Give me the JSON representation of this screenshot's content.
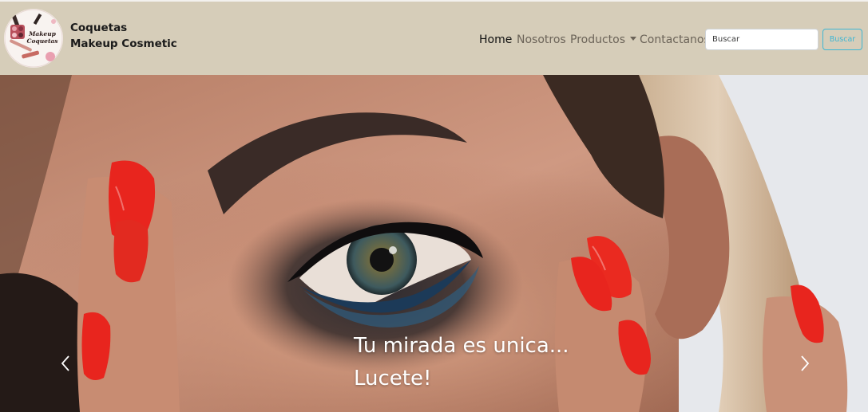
{
  "brand": {
    "logo_text": "Makeup Coquetas",
    "line1": "Coquetas",
    "line2": "Makeup Cosmetic"
  },
  "nav": {
    "items": [
      {
        "label": "Home",
        "active": true
      },
      {
        "label": "Nosotros",
        "active": false
      },
      {
        "label": "Productos",
        "active": false,
        "dropdown": true
      },
      {
        "label": "Contactanos",
        "active": false
      }
    ]
  },
  "search": {
    "placeholder": "Buscar",
    "value": "",
    "button_label": "Buscar"
  },
  "carousel": {
    "caption_line1": "Tu mirada es unica...",
    "caption_line2": "Lucete!",
    "prev_icon": "chevron-left-icon",
    "next_icon": "chevron-right-icon"
  },
  "colors": {
    "navbar_bg": "#d6cdb9",
    "nav_text": "#6b6358",
    "nav_active": "#121212",
    "button_accent": "#3fb6d3",
    "nail_red": "#e8251e"
  }
}
